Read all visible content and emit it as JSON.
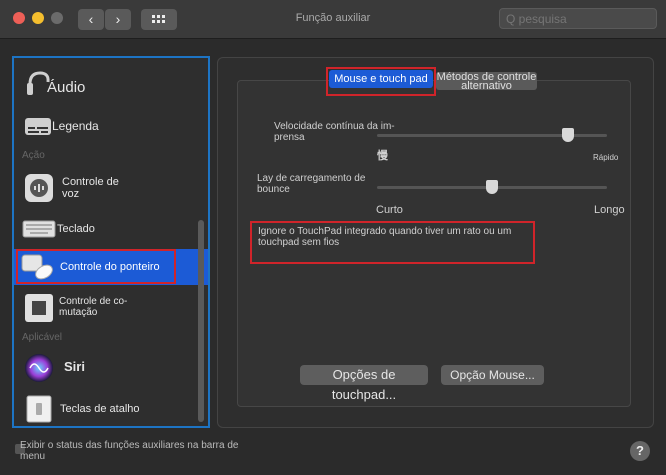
{
  "window": {
    "title": "Função auxiliar"
  },
  "search": {
    "placeholder": "Q pesquisa"
  },
  "nav": {
    "back": "‹",
    "forward": "›"
  },
  "sidebar": {
    "items": [
      {
        "label": "Áudio",
        "icon": "audio-icon"
      },
      {
        "label": "Legenda",
        "icon": "caption-icon"
      },
      {
        "label": "Controle de voz",
        "icon": "voice-control-icon"
      },
      {
        "label": "Teclado",
        "icon": "keyboard-icon"
      },
      {
        "label": "Controle do ponteiro",
        "icon": "pointer-icon"
      },
      {
        "label": "Controle de co-mutação",
        "icon": "switch-control-icon"
      },
      {
        "label": "Siri",
        "icon": "siri-icon"
      },
      {
        "label": "Teclas de atalho",
        "icon": "shortcut-icon"
      }
    ],
    "sections": {
      "action": "Ação",
      "apps": "Aplicável"
    }
  },
  "tabs": [
    {
      "label": "Mouse e touch pad",
      "selected": true
    },
    {
      "label": "Métodos de controle alternativo",
      "selected": false
    }
  ],
  "speed": {
    "label": "Velocidade contínua da im-prensa",
    "left": "慢",
    "right": "Rápido",
    "value": 0.83
  },
  "delay": {
    "label": "Lay de carregamento de bounce",
    "left": "Curto",
    "right": "Longo",
    "value": 0.5
  },
  "ignore": {
    "label": "Ignore o TouchPad integrado quando tiver um rato ou um touchpad sem fios"
  },
  "buttons": {
    "touchpad": "Opções de touchpad...",
    "mouse": "Opção Mouse..."
  },
  "footer": {
    "status": "Exibir o status das funções auxiliares na barra de menu",
    "help": "?"
  },
  "colors": {
    "accent": "#1d74c4",
    "highlight": "#d0242a",
    "selected": "#1c5bd6"
  }
}
